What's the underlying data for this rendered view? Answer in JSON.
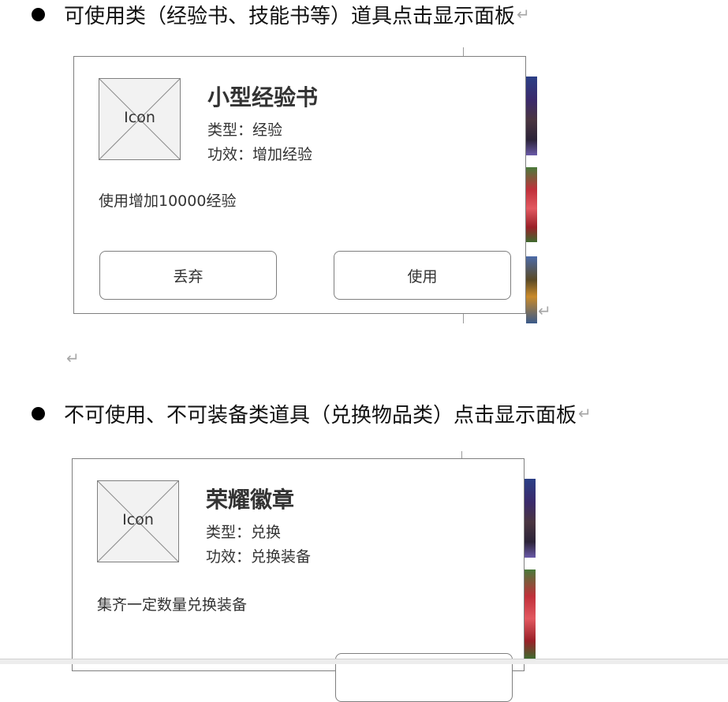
{
  "sections": [
    {
      "heading": "可使用类（经验书、技能书等）道具点击显示面板",
      "panel": {
        "icon_label": "Icon",
        "title": "小型经验书",
        "type_line": "类型：经验",
        "effect_line": "功效：增加经验",
        "description": "使用增加10000经验",
        "buttons": [
          "丢弃",
          "使用"
        ]
      }
    },
    {
      "heading": "不可使用、不可装备类道具（兑换物品类）点击显示面板",
      "panel": {
        "icon_label": "Icon",
        "title": "荣耀徽章",
        "type_line": "类型：兑换",
        "effect_line": "功效：兑换装备",
        "description": "集齐一定数量兑换装备"
      }
    }
  ],
  "paragraph_mark": "↵"
}
